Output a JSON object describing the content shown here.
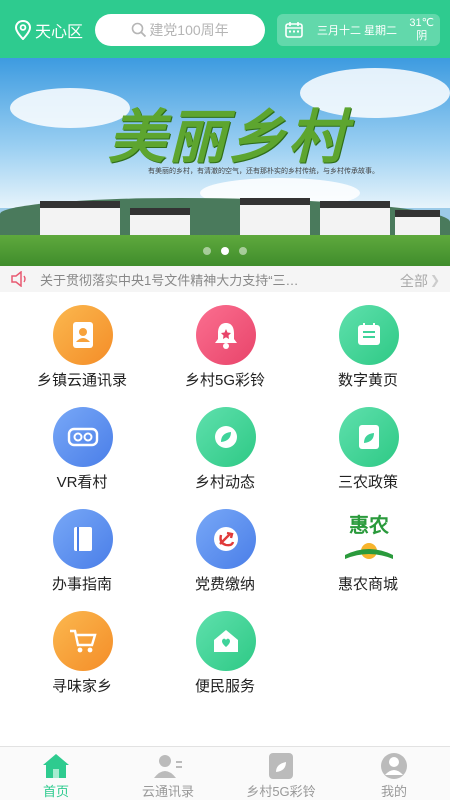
{
  "header": {
    "location": "天心区",
    "search_placeholder": "建党100周年",
    "date": "三月十二 星期二",
    "temperature": "31℃",
    "weather": "阴",
    "brand_color": "#2ecb8f"
  },
  "banner": {
    "title": "美丽乡村",
    "subtitle": "有美丽的乡村，有清澈的空气，还有那朴实的乡村传统，与乡村传承故事。",
    "slide_count": 3,
    "active_slide": 2
  },
  "notice": {
    "text": "关于贯彻落实中央1号文件精神大力支持“三…",
    "all_label": "全部"
  },
  "services": [
    {
      "label": "乡镇云通讯录",
      "icon": "contacts-icon",
      "color": "#f7a23b"
    },
    {
      "label": "乡村5G彩铃",
      "icon": "bell-icon",
      "color": "#f2527a"
    },
    {
      "label": "数字黄页",
      "icon": "yellow-pages-icon",
      "color": "#3fd39a"
    },
    {
      "label": "VR看村",
      "icon": "vr-icon",
      "color": "#5a8ff0"
    },
    {
      "label": "乡村动态",
      "icon": "leaf-icon",
      "color": "#3fd39a"
    },
    {
      "label": "三农政策",
      "icon": "policy-icon",
      "color": "#3fd39a"
    },
    {
      "label": "办事指南",
      "icon": "book-icon",
      "color": "#5a8ff0"
    },
    {
      "label": "党费缴纳",
      "icon": "party-emblem-icon",
      "color": "#5a8ff0"
    },
    {
      "label": "惠农商城",
      "icon": "huinong-logo-icon",
      "color": "#ffffff",
      "logo_text": "惠农"
    },
    {
      "label": "寻味家乡",
      "icon": "cart-icon",
      "color": "#f7a23b"
    },
    {
      "label": "便民服务",
      "icon": "home-heart-icon",
      "color": "#3fd39a"
    }
  ],
  "tabbar": {
    "items": [
      {
        "label": "首页",
        "icon": "home-icon",
        "active": true
      },
      {
        "label": "云通讯录",
        "icon": "contacts-tab-icon",
        "active": false
      },
      {
        "label": "乡村5G彩铃",
        "icon": "ringtone-tab-icon",
        "active": false
      },
      {
        "label": "我的",
        "icon": "user-icon",
        "active": false
      }
    ]
  }
}
